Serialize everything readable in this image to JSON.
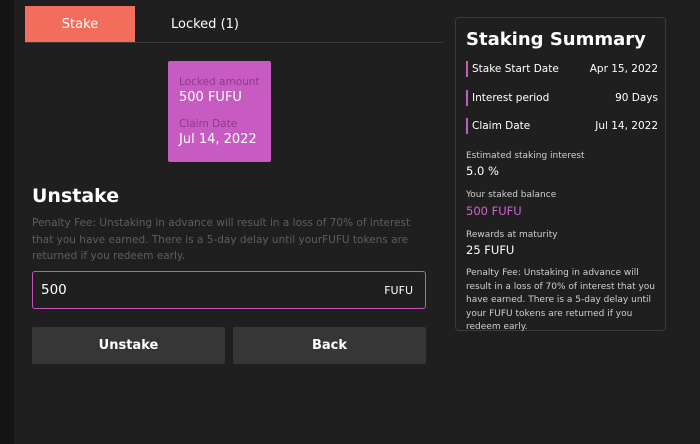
{
  "tabs": {
    "stake": "Stake",
    "locked": "Locked (1)"
  },
  "locked_card": {
    "amount_label": "Locked amount",
    "amount_value": "500 FUFU",
    "claim_label": "Claim Date",
    "claim_value": "Jul 14, 2022"
  },
  "unstake": {
    "title": "Unstake",
    "penalty_text": "Penalty Fee: Unstaking in advance will result in a loss of 70% of interest that you have earned. There is a 5-day delay until yourFUFU tokens are returned if you redeem early.",
    "amount_value": "500",
    "amount_unit": "FUFU",
    "unstake_button": "Unstake",
    "back_button": "Back"
  },
  "summary": {
    "title": "Staking Summary",
    "rows": [
      {
        "label": "Stake Start Date",
        "value": "Apr 15, 2022"
      },
      {
        "label": "Interest period",
        "value": "90 Days"
      },
      {
        "label": "Claim Date",
        "value": "Jul 14, 2022"
      }
    ],
    "estimated_label": "Estimated staking interest",
    "estimated_value": "5.0 %",
    "balance_label": "Your staked balance",
    "balance_value": "500 FUFU",
    "rewards_label": "Rewards at maturity",
    "rewards_value": "25 FUFU",
    "penalty_text": "Penalty Fee: Unstaking in advance will result in a loss of 70% of interest that you have earned. There is a 5-day delay until your FUFU tokens are returned if you redeem early."
  },
  "colors": {
    "accent_tab": "#f26d5b",
    "accent_pink": "#c85bc1",
    "background": "#1f1f1f",
    "button": "#363636"
  }
}
